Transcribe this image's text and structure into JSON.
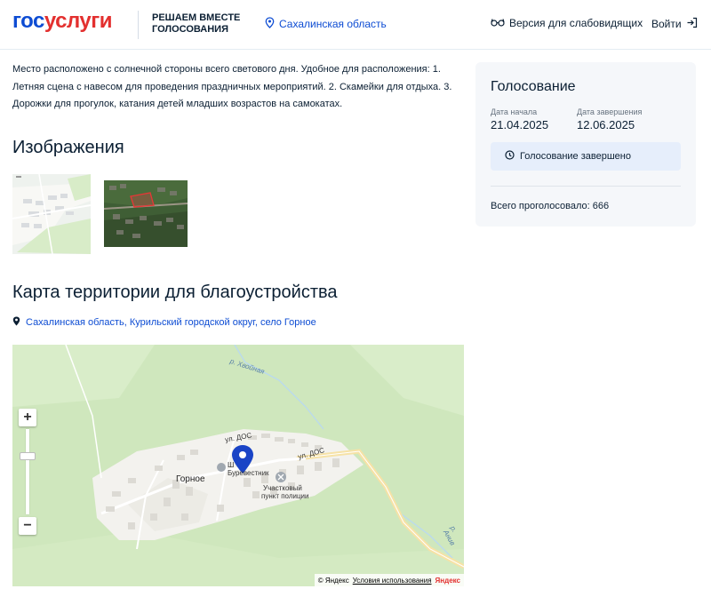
{
  "header": {
    "logo_part1": "гос",
    "logo_part2": "услуги",
    "project_line1": "РЕШАЕМ ВМЕСТЕ",
    "project_line2": "ГОЛОСОВАНИЯ",
    "region": "Сахалинская область",
    "vision": "Версия для слабовидящих",
    "login": "Войти"
  },
  "description": "Место расположено с солнечной стороны всего светового дня. Удобное для расположения: 1. Летняя сцена с навесом для проведения праздничных мероприятий. 2. Скамейки для отдыха. 3. Дорожки для прогулок, катания детей младших возрастов на самокатах.",
  "images": {
    "heading": "Изображения"
  },
  "map_section": {
    "heading": "Карта территории для благоустройства",
    "address": "Сахалинская область, Курильский городской округ, село Горное",
    "labels": {
      "village": "Горное",
      "street1": "ул. ДОС",
      "street2": "ул. ДОС",
      "school": "Ш",
      "burevestnik": "Буревестник",
      "police1": "Участковый",
      "police2": "пункт полиции",
      "river1": "р. Хвойная",
      "river2": "р. Анив"
    },
    "copyright": "© Яндекс",
    "terms": "Условия использования",
    "yandex_logo": "Яндекс",
    "zoom_in": "+",
    "zoom_out": "−"
  },
  "voting": {
    "title": "Голосование",
    "start_label": "Дата начала",
    "start_date": "21.04.2025",
    "end_label": "Дата завершения",
    "end_date": "12.06.2025",
    "status": "Голосование завершено",
    "total": "Всего проголосовало: 666"
  },
  "colors": {
    "brand_blue": "#0d4cd3",
    "brand_red": "#e3302f",
    "card_bg": "#f5f7fa",
    "status_bg": "#e6eefb"
  }
}
